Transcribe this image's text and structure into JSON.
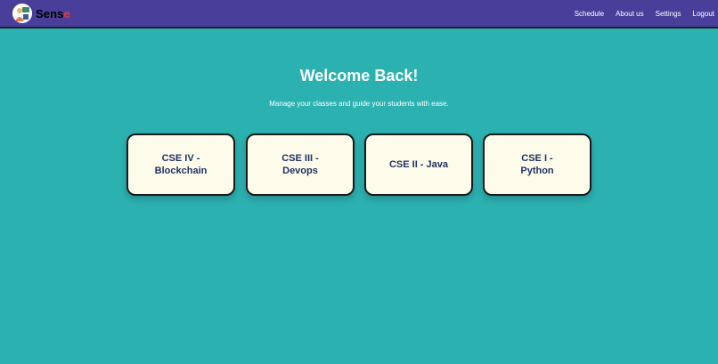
{
  "brand": {
    "name_part1": "Sens",
    "name_part2": "e"
  },
  "nav": {
    "items": [
      "Schedule",
      "About us",
      "Settings",
      "Logout"
    ]
  },
  "hero": {
    "title": "Welcome Back!",
    "subtitle": "Manage your classes and guide your students with ease."
  },
  "classes": [
    {
      "label": "CSE IV - Blockchain"
    },
    {
      "label": "CSE III - Devops"
    },
    {
      "label": "CSE II - Java"
    },
    {
      "label": "CSE I - Python"
    }
  ],
  "colors": {
    "navbar": "#4a3e9b",
    "background": "#2cb1b1",
    "card_bg": "#fdfbe9",
    "card_text": "#223366",
    "logo_accent": "#e0393a"
  }
}
